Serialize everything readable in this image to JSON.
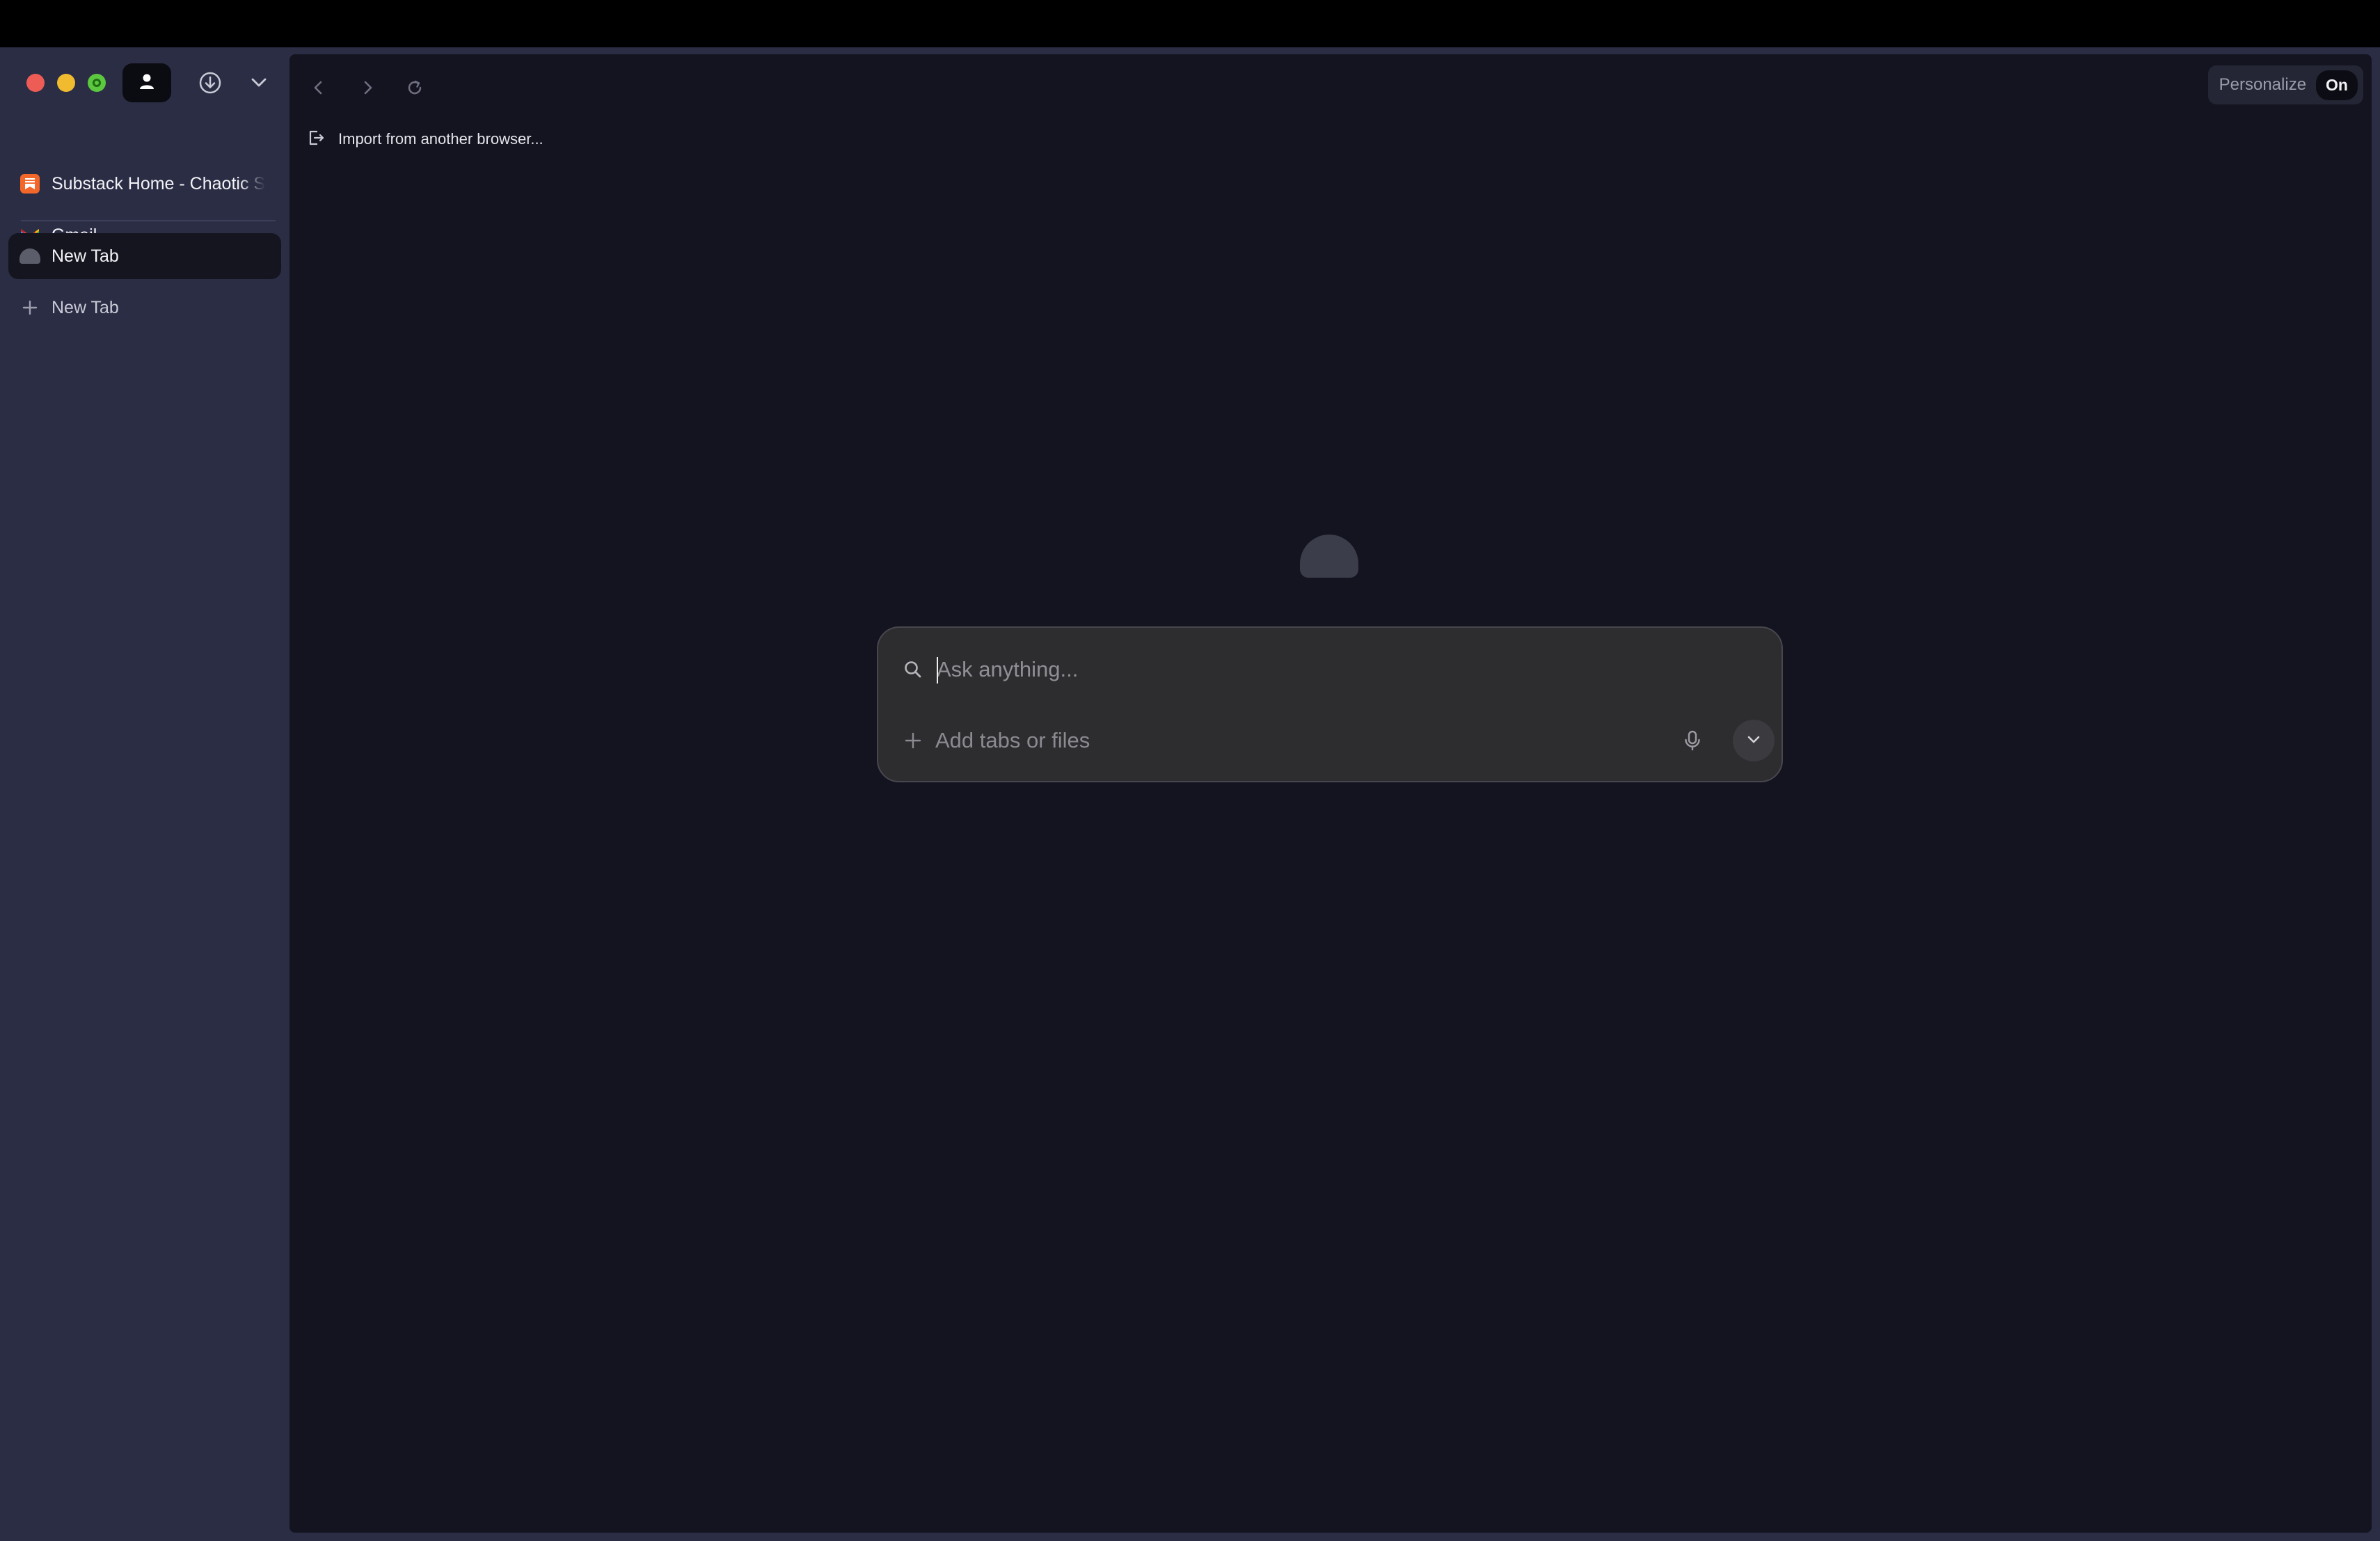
{
  "window": {
    "traffic_lights": [
      "close",
      "minimize",
      "fullscreen"
    ]
  },
  "sidebar": {
    "toolbar": {
      "profile_icon": "person-icon",
      "download_icon": "download-icon",
      "menu_icon": "chevron-down-icon"
    },
    "pinned": [
      {
        "label": "Substack Home - Chaotic S",
        "icon": "substack-icon",
        "color": "#f3672a"
      },
      {
        "label": "Gmail",
        "icon": "gmail-icon"
      }
    ],
    "tabs": [
      {
        "label": "New Tab",
        "active": true,
        "icon": "comet-icon"
      }
    ],
    "new_tab_label": "New Tab"
  },
  "toolbar": {
    "back_icon": "chevron-left-icon",
    "forward_icon": "chevron-right-icon",
    "reload_icon": "reload-icon",
    "personalize_label": "Personalize",
    "personalize_state": "On"
  },
  "main": {
    "import_label": "Import from another browser...",
    "search": {
      "placeholder": "Ask anything...",
      "value": "",
      "add_label": "Add tabs or files"
    }
  },
  "colors": {
    "sidebar_bg": "#2b2d45",
    "main_bg": "#131420",
    "search_bg": "#2d2d30",
    "active_tab_bg": "#14151f"
  }
}
